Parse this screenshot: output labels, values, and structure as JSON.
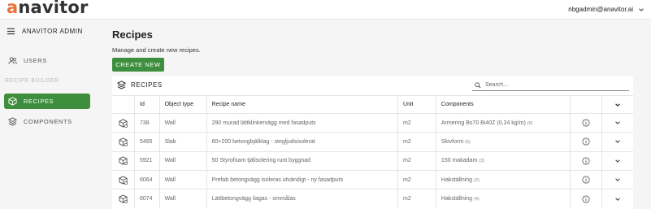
{
  "brand": {
    "logo_text": "anavitor",
    "accent_color": "#e8743b"
  },
  "header": {
    "user_email": "nbgadmin@anavitor.ai"
  },
  "sidebar": {
    "title": "ANAVITOR ADMIN",
    "items": [
      {
        "label": "USERS",
        "icon": "users-icon",
        "active": false
      },
      {
        "label": "RECIPES",
        "icon": "box-icon",
        "active": true
      },
      {
        "label": "COMPONENTS",
        "icon": "layers-icon",
        "active": false
      }
    ],
    "section_label": "RECIPE BUILDER",
    "active_color": "#3d8f3d"
  },
  "main": {
    "title": "Recipes",
    "subtitle": "Manage and create new recipes.",
    "create_button": "CREATE NEW",
    "card_title": "RECIPES",
    "search_placeholder": "Search...",
    "columns": [
      "Id",
      "Object type",
      "Recipe name",
      "Unit",
      "Components"
    ],
    "rows": [
      {
        "id": "738",
        "object_type": "Wall",
        "recipe_name": "290 murad lättklinkervägg med fasadputs",
        "unit": "m2",
        "component": "Armering Bs70 Bi40Z (0,24 kg/m)",
        "count": "(6)"
      },
      {
        "id": "5485",
        "object_type": "Slab",
        "recipe_name": "60+200 betongbjälklag - stegljudsisolerat",
        "unit": "m2",
        "component": "Skivform",
        "count": "(5)"
      },
      {
        "id": "5921",
        "object_type": "Wall",
        "recipe_name": "50 Styrofoam tjälisolering runt byggnad",
        "unit": "m2",
        "component": "150 makadam",
        "count": "(3)"
      },
      {
        "id": "6064",
        "object_type": "Wall",
        "recipe_name": "Prefab betongvägg isoleras utvändigt - ny fasadputs",
        "unit": "m2",
        "component": "Hakställning",
        "count": "(2)"
      },
      {
        "id": "6074",
        "object_type": "Wall",
        "recipe_name": "Lättbetongvägg ilagas - ommålas",
        "unit": "m2",
        "component": "Hakställning",
        "count": "(4)"
      }
    ]
  }
}
